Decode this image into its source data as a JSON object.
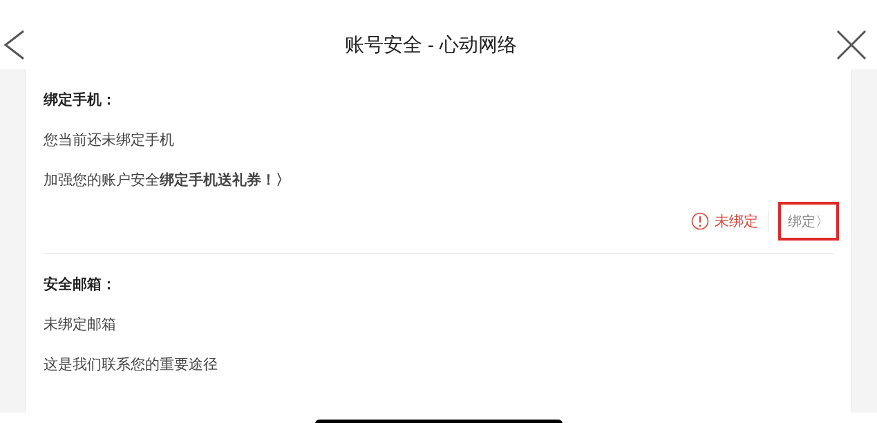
{
  "header": {
    "title": "账号安全 - 心动网络"
  },
  "sections": [
    {
      "title": "绑定手机：",
      "lines": [
        "您当前还未绑定手机",
        "加强您的账户安全**绑定手机送礼券！〉**"
      ],
      "status": {
        "text": "未绑定",
        "bound": false
      },
      "action": {
        "label": "绑定〉",
        "highlighted": true
      }
    },
    {
      "title": "安全邮箱：",
      "lines": [
        "未绑定邮箱",
        "这是我们联系您的重要途径"
      ]
    }
  ]
}
